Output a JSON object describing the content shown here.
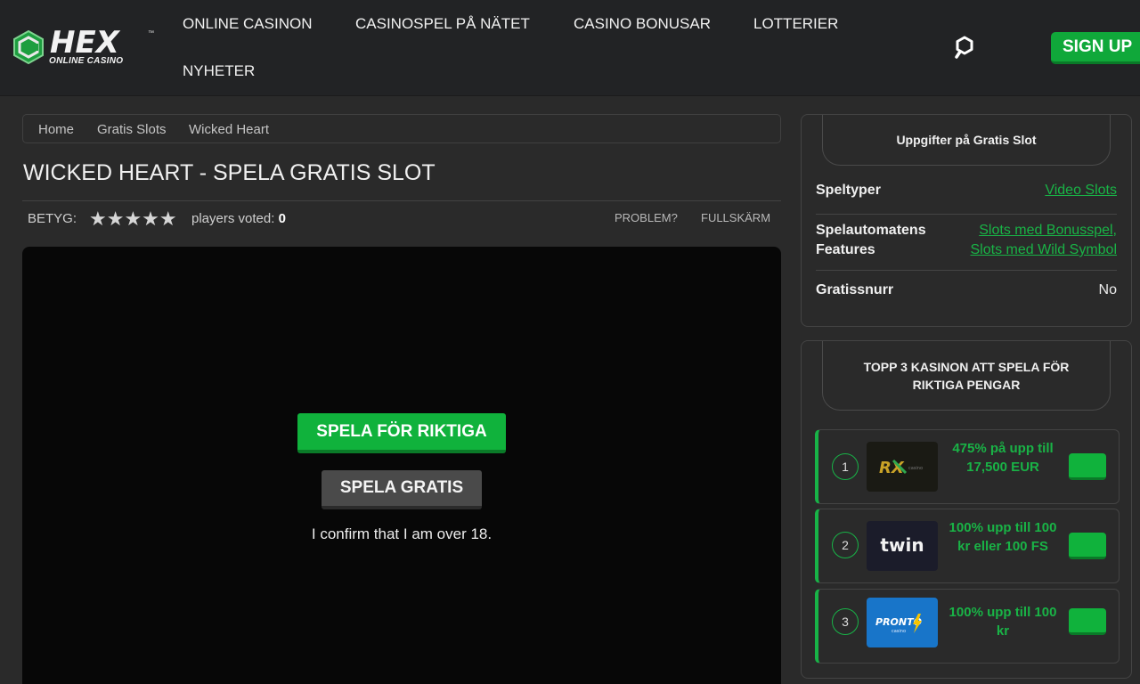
{
  "header": {
    "logo_text": "HEX",
    "logo_subtext": "ONLINE CASINO",
    "logo_tm": "™",
    "nav": [
      {
        "label": "ONLINE CASINON"
      },
      {
        "label": "CASINOSPEL PÅ NÄTET"
      },
      {
        "label": "CASINO BONUSAR"
      },
      {
        "label": "LOTTERIER"
      },
      {
        "label": "NYHETER"
      }
    ],
    "signup_label": "SIGN UP",
    "accent_color": "#10a83a"
  },
  "breadcrumb": [
    "Home",
    "Gratis Slots",
    "Wicked Heart"
  ],
  "page": {
    "title": "WICKED HEART - SPELA GRATIS SLOT",
    "rating_label": "BETYG:",
    "stars_text": "★★★★★",
    "rating_value": 0,
    "rating_max": 5,
    "players_voted_label": "players voted:",
    "players_voted_count": "0",
    "problem_label": "PROBLEM?",
    "fullscreen_label": "FULLSKÄRM"
  },
  "game": {
    "play_real_label": "SPELA FÖR RIKTIGA",
    "play_free_label": "SPELA GRATIS",
    "confirm_text": "I confirm that I am over 18."
  },
  "info_card": {
    "title": "Uppgifter på Gratis Slot",
    "rows": [
      {
        "key": "Speltyper",
        "values": [
          "Video Slots"
        ]
      },
      {
        "key": "Spelautomatens Features",
        "values": [
          "Slots med Bonusspel,",
          "Slots med Wild Symbol"
        ]
      },
      {
        "key": "Gratissnurr",
        "value": "No"
      }
    ]
  },
  "top_casinos": {
    "title": "TOPP 3 KASINON ATT SPELA FÖR RIKTIGA PENGAR",
    "items": [
      {
        "rank": "1",
        "logo_text": "RX",
        "bonus": "475% på upp till 17,500 EUR"
      },
      {
        "rank": "2",
        "logo_text": "twin",
        "bonus": "100% upp till 100 kr eller 100 FS"
      },
      {
        "rank": "3",
        "logo_text": "PRONTO",
        "bonus": "100% upp till 100 kr"
      }
    ]
  }
}
